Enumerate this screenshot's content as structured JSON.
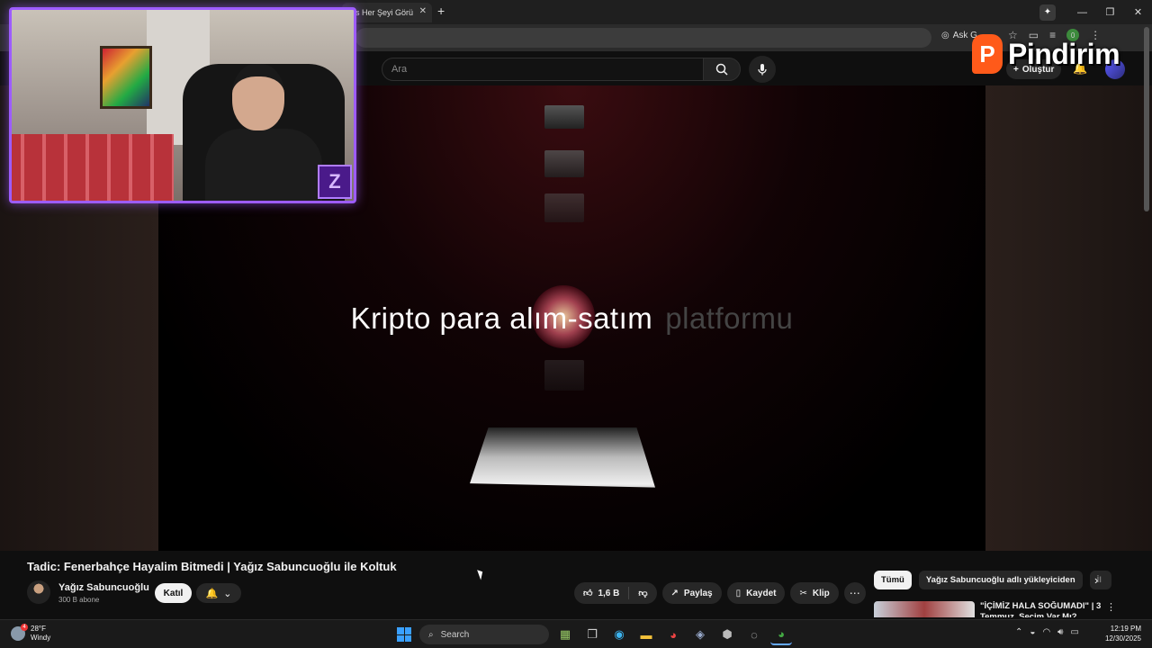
{
  "browser": {
    "tab_title": "olis Her Şeyi Görü",
    "tab_close": "✕",
    "new_tab": "+",
    "ask": "Ask G",
    "profile_initial": "0"
  },
  "youtube": {
    "search_placeholder": "Ara",
    "create_label": "Oluştur"
  },
  "video": {
    "headline_main": "Kripto para alım-satım",
    "headline_dim": "platformu"
  },
  "watermark": {
    "badge": "P",
    "text": "Pindirim"
  },
  "webcam": {
    "logo": "Z"
  },
  "info": {
    "title": "Tadic: Fenerbahçe Hayalim Bitmedi | Yağız Sabuncuoğlu ile Koltuk",
    "channel": "Yağız Sabuncuoğlu",
    "subscribers": "300 B abone",
    "join": "Katıl",
    "likes": "1,6 B",
    "share": "Paylaş",
    "save": "Kaydet",
    "clip": "Klip"
  },
  "chips": {
    "items": [
      "Tümü",
      "Yağız Sabuncuoğlu adlı yükleyiciden",
      "İl"
    ]
  },
  "reco": {
    "title": "\"İÇİMİZ HALA SOĞUMADI\" | 3 Temmuz, Seçim Var Mı?"
  },
  "taskbar": {
    "temperature": "28°F",
    "condition": "Windy",
    "search": "Search",
    "time": "12:19 PM",
    "date": "12/30/2025",
    "notif": "4"
  },
  "colors": {
    "accent_purple": "#9d5cff",
    "watermark_orange": "#ff5a1a",
    "bg": "#0f0f0f"
  }
}
